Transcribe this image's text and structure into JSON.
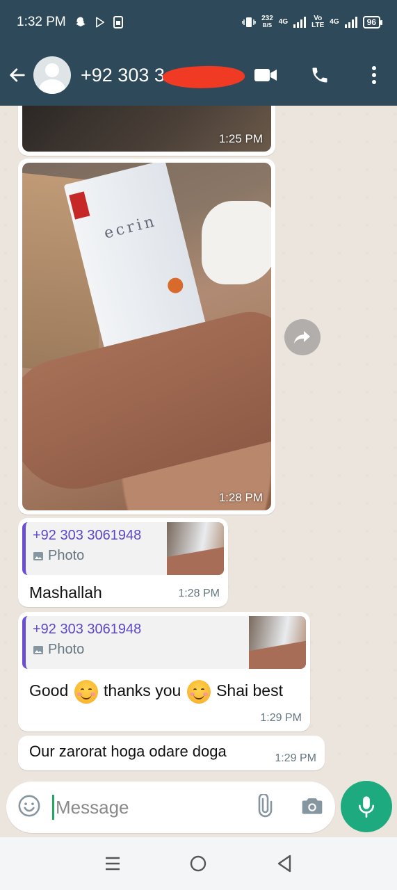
{
  "status_bar": {
    "time": "1:32 PM",
    "data_rate": "232",
    "data_rate_unit": "B/S",
    "net1": "4G",
    "volte_top": "Vo",
    "volte_bottom": "LTE",
    "net2": "4G",
    "battery": "96"
  },
  "header": {
    "contact_name": "+92 303 3"
  },
  "messages": [
    {
      "type": "image",
      "time": "1:25 PM"
    },
    {
      "type": "image",
      "time": "1:28 PM",
      "brand_text": "ecrin"
    },
    {
      "type": "reply",
      "quoted_author": "+92 303 3061948",
      "quoted_type": "Photo",
      "text": "Mashallah",
      "time": "1:28 PM"
    },
    {
      "type": "reply",
      "quoted_author": "+92 303 3061948",
      "quoted_type": "Photo",
      "text_part1": "Good",
      "text_part2": "thanks you",
      "text_part3": "Shai best",
      "time": "1:29 PM"
    },
    {
      "type": "text",
      "text": "Our zarorat hoga odare doga",
      "time": "1:29 PM"
    }
  ],
  "input": {
    "placeholder": "Message"
  },
  "colors": {
    "header_bg": "#2e4a5a",
    "chat_bg": "#ece5dd",
    "accent": "#1daa7e",
    "quote_bar": "#6a4fd6",
    "quote_author": "#5d48c8"
  },
  "icons": [
    "snapchat-icon",
    "play-store-icon",
    "sim-icon",
    "vibrate-icon",
    "signal-icon",
    "back-arrow-icon",
    "video-call-icon",
    "phone-call-icon",
    "more-vert-icon",
    "forward-icon",
    "photo-icon",
    "emoji-icon",
    "attach-icon",
    "camera-icon",
    "mic-icon",
    "recents-icon",
    "home-icon",
    "back-nav-icon"
  ]
}
